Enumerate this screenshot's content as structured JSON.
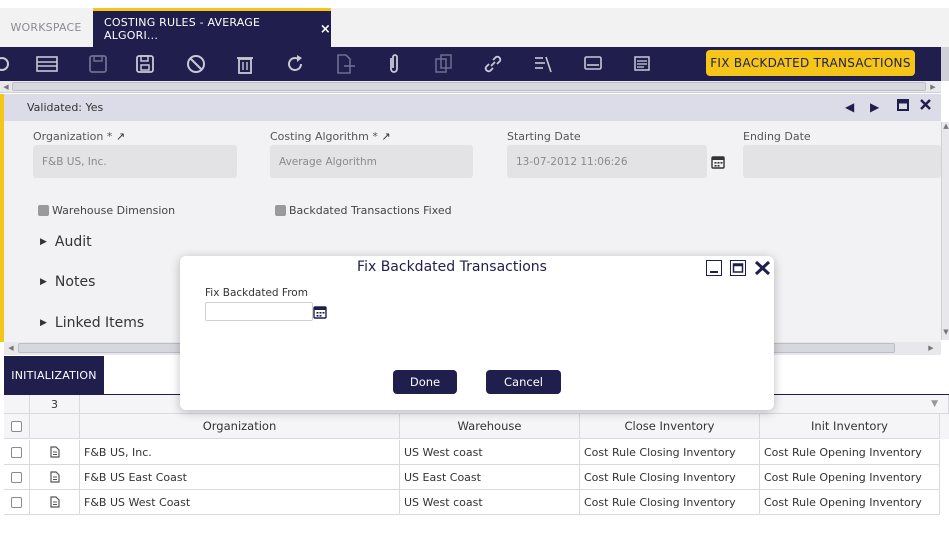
{
  "tabs": {
    "workspace": "WORKSPACE",
    "active": "COSTING RULES - AVERAGE ALGORI...",
    "close_glyph": "×"
  },
  "toolbar": {
    "fix_backdated_label": "FIX BACKDATED TRANSACTIONS",
    "icons": [
      "new-document-icon",
      "new-record-icon",
      "save-icon",
      "save-and-close-icon",
      "cancel-icon",
      "delete-icon",
      "refresh-icon",
      "export-icon",
      "attachment-icon",
      "copy-icon",
      "link-icon",
      "audit-icon",
      "grid-view-icon",
      "notes-icon"
    ]
  },
  "record": {
    "status": "Validated: Yes",
    "fields": {
      "organization": {
        "label": "Organization *",
        "value": "F&B US, Inc."
      },
      "costing_algorithm": {
        "label": "Costing Algorithm *",
        "value": "Average Algorithm"
      },
      "starting_date": {
        "label": "Starting Date",
        "value": "13-07-2012 11:06:26"
      },
      "ending_date": {
        "label": "Ending Date",
        "value": ""
      }
    },
    "checkboxes": {
      "warehouse_dimension": "Warehouse Dimension",
      "backdated_fixed": "Backdated Transactions Fixed"
    },
    "sections": [
      "Audit",
      "Notes",
      "Linked Items"
    ]
  },
  "subtab": {
    "label": "INITIALIZATION",
    "record_count": "3"
  },
  "grid": {
    "columns": [
      "Organization",
      "Warehouse",
      "Close Inventory",
      "Init Inventory"
    ],
    "rows": [
      [
        "F&B US, Inc.",
        "US West coast",
        "Cost Rule Closing Inventory",
        "Cost Rule Opening Inventory"
      ],
      [
        "F&B US East Coast",
        "US East Coast",
        "Cost Rule Closing Inventory",
        "Cost Rule Opening Inventory"
      ],
      [
        "F&B US West Coast",
        "US West coast",
        "Cost Rule Closing Inventory",
        "Cost Rule Opening Inventory"
      ]
    ]
  },
  "dialog": {
    "title": "Fix Backdated Transactions",
    "field_label": "Fix Backdated From",
    "field_value": "",
    "done_label": "Done",
    "cancel_label": "Cancel"
  },
  "colors": {
    "primary": "#1f1e4d",
    "accent": "#f5c518"
  }
}
